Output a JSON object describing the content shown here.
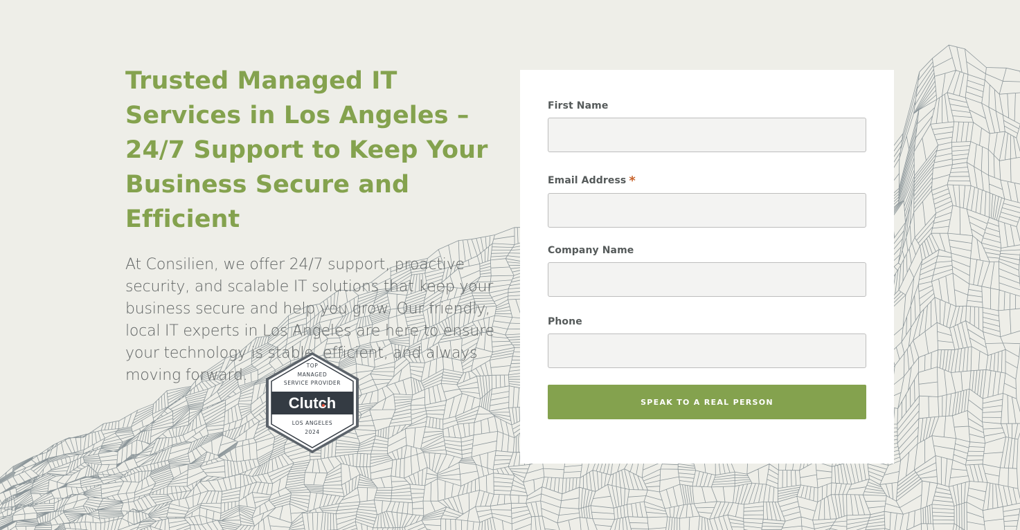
{
  "hero": {
    "headline": "Trusted Managed IT Services in Los Angeles – 24/7 Support to Keep Your Business Secure and Efficient",
    "intro": "At Consilien, we offer 24/7 support, proactive security, and scalable IT solutions that keep your business secure and help you grow. Our friendly, local IT experts in Los Angeles are here to ensure your technology is stable, efficient, and always moving forward."
  },
  "badge": {
    "line1": "TOP",
    "line2": "MANAGED",
    "line3": "SERVICE PROVIDER",
    "brand": "Clutch",
    "location": "LOS ANGELES",
    "year": "2024"
  },
  "form": {
    "first_name_label": "First Name",
    "first_name_value": "",
    "email_label": "Email Address",
    "required_mark": "*",
    "email_value": "",
    "company_label": "Company Name",
    "company_value": "",
    "phone_label": "Phone",
    "phone_value": "",
    "submit_label": "SPEAK TO A REAL PERSON"
  },
  "colors": {
    "accent": "#84a24e",
    "background": "#eeeee8",
    "required": "#c8622a",
    "badge_dark": "#343b43"
  }
}
